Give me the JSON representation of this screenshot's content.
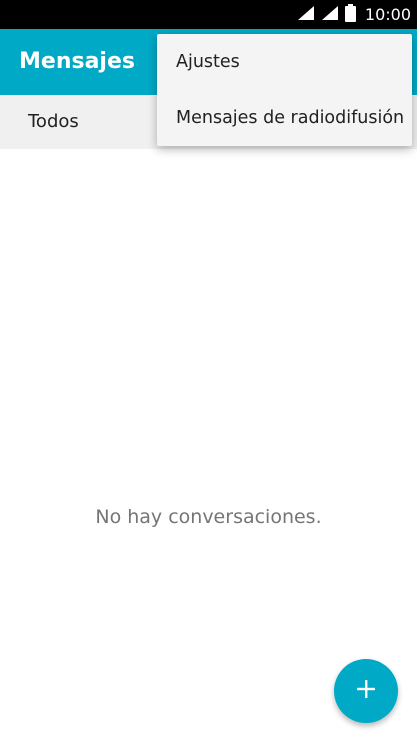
{
  "status_bar": {
    "time": "10:00",
    "icons": [
      "wifi-icon",
      "cellular-signal-icon",
      "battery-icon"
    ]
  },
  "app_bar": {
    "title": "Mensajes",
    "background": "#00a9c6"
  },
  "filter": {
    "label": "Todos"
  },
  "empty_state": {
    "message": "No hay conversaciones."
  },
  "fab": {
    "icon": "plus-icon",
    "color": "#00a9c6"
  },
  "overflow_menu": {
    "items": [
      {
        "label": "Ajustes"
      },
      {
        "label": "Mensajes de radiodifusión"
      }
    ]
  }
}
